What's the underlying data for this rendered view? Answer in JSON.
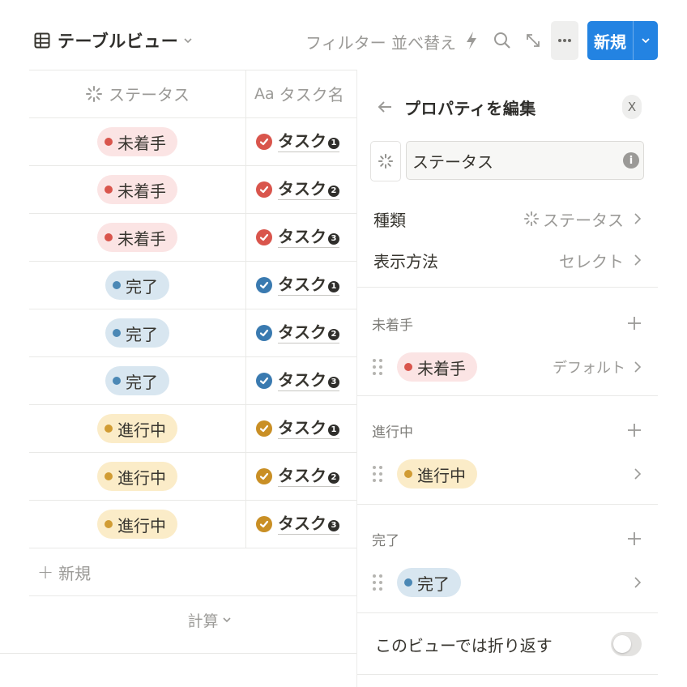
{
  "toolbar": {
    "view_title": "テーブルビュー",
    "filter_label": "フィルター",
    "sort_label": "並べ替え",
    "new_label": "新規"
  },
  "table": {
    "headers": {
      "status": "ステータス",
      "name_prefix": "Aa",
      "name": "タスク名"
    },
    "rows": [
      {
        "status": "未着手",
        "status_color": "red",
        "task": "タスク",
        "num": "1"
      },
      {
        "status": "未着手",
        "status_color": "red",
        "task": "タスク",
        "num": "2"
      },
      {
        "status": "未着手",
        "status_color": "red",
        "task": "タスク",
        "num": "3"
      },
      {
        "status": "完了",
        "status_color": "blue",
        "task": "タスク",
        "num": "1"
      },
      {
        "status": "完了",
        "status_color": "blue",
        "task": "タスク",
        "num": "2"
      },
      {
        "status": "完了",
        "status_color": "blue",
        "task": "タスク",
        "num": "3"
      },
      {
        "status": "進行中",
        "status_color": "yellow",
        "task": "タスク",
        "num": "1"
      },
      {
        "status": "進行中",
        "status_color": "yellow",
        "task": "タスク",
        "num": "2"
      },
      {
        "status": "進行中",
        "status_color": "yellow",
        "task": "タスク",
        "num": "3"
      }
    ],
    "add_label": "新規",
    "calc_label": "計算"
  },
  "panel": {
    "title": "プロパティを編集",
    "close": "X",
    "name_value": "ステータス",
    "info": "i",
    "type_key": "種類",
    "type_value": "ステータス",
    "display_key": "表示方法",
    "display_value": "セレクト",
    "groups": [
      {
        "name": "未着手",
        "option": "未着手",
        "color": "red",
        "default_label": "デフォルト"
      },
      {
        "name": "進行中",
        "option": "進行中",
        "color": "yellow"
      },
      {
        "name": "完了",
        "option": "完了",
        "color": "blue"
      }
    ],
    "wrap_label": "このビューでは折り返す",
    "wrap_enabled": false
  },
  "colors": {
    "accent": "#2383e2",
    "red": "#d9554c",
    "blue": "#4b88b5",
    "yellow": "#d19c33"
  }
}
